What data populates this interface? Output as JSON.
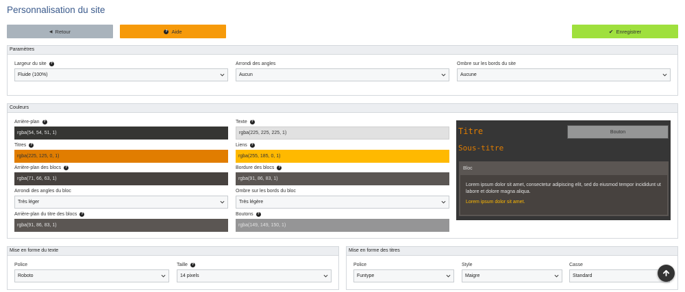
{
  "page": {
    "title": "Personnalisation du site"
  },
  "toolbar": {
    "back_label": "Retour",
    "help_label": "Aide",
    "save_label": "Enregistrer",
    "back_color": "#a9b3bc",
    "help_color": "#f69a0a",
    "save_color": "#9fe03d"
  },
  "parametres": {
    "title": "Paramètres",
    "width_label": "Largeur du site",
    "width_value": "Fluide (100%)",
    "radius_label": "Arrondi des angles",
    "radius_value": "Aucun",
    "shadow_label": "Ombre sur les bords du site",
    "shadow_value": "Aucune"
  },
  "couleurs": {
    "title": "Couleurs",
    "background_label": "Arrière-plan",
    "background_value": "rgba(54, 54, 51, 1)",
    "text_label": "Texte",
    "text_value": "rgba(225, 225, 225, 1)",
    "titles_label": "Titres",
    "titles_value": "rgba(225, 125, 0, 1)",
    "links_label": "Liens",
    "links_value": "rgba(255, 185, 0, 1)",
    "block_bg_label": "Arrière-plan des blocs",
    "block_bg_value": "rgba(71, 66, 63, 1)",
    "block_border_label": "Bordure des blocs",
    "block_border_value": "rgba(91, 86, 83, 1)",
    "block_radius_label": "Arrondi des angles du bloc",
    "block_radius_value": "Très léger",
    "block_shadow_label": "Ombre sur les bords du bloc",
    "block_shadow_value": "Très légère",
    "block_title_bg_label": "Arrière-plan du titre des blocs",
    "block_title_bg_value": "rgba(91, 86, 83, 1)",
    "buttons_label": "Boutons",
    "buttons_value": "rgba(149, 149, 150, 1)"
  },
  "preview": {
    "title": "Titre",
    "subtitle": "Sous-titre",
    "button": "Bouton",
    "block_title": "Bloc",
    "body_text": "Lorem ipsum dolor sit amet, consectetur adipiscing elit, sed do eiusmod tempor incididunt ut labore et dolore magna aliqua.",
    "link_text": "Lorem ipsum dolor sit amet."
  },
  "text_format": {
    "title": "Mise en forme du texte",
    "font_label": "Police",
    "font_value": "Roboto",
    "size_label": "Taille",
    "size_value": "14 pixels"
  },
  "titles_format": {
    "title": "Mise en forme des titres",
    "font_label": "Police",
    "font_value": "Funtype",
    "style_label": "Style",
    "style_value": "Maigre",
    "case_label": "Casse",
    "case_value": "Standard"
  },
  "icons": [
    "arrow-left-icon",
    "question-circle-icon",
    "check-icon",
    "chevron-down-icon",
    "arrow-up-icon"
  ]
}
